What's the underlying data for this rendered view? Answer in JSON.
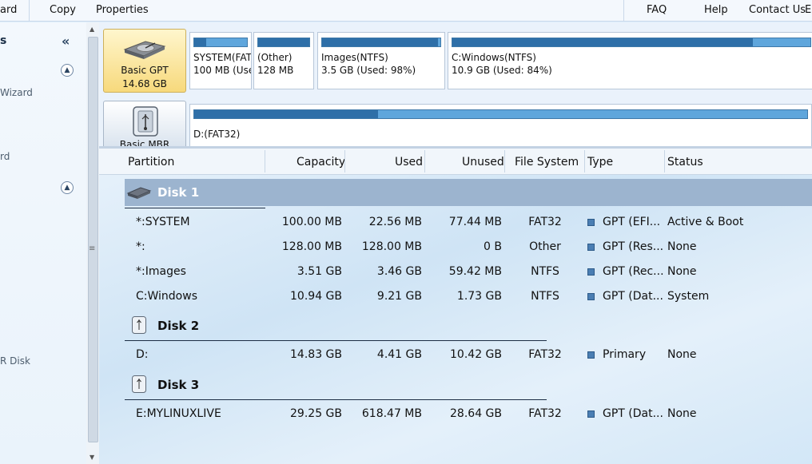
{
  "menu": {
    "wizard_fragment": "ard",
    "copy": "Copy",
    "properties": "Properties",
    "faq": "FAQ",
    "help": "Help",
    "contact": "Contact Us",
    "edge_fragment": "E"
  },
  "sidebar": {
    "head_fragment": "s",
    "item1": "Wizard",
    "item2": "rd",
    "item3": "R Disk"
  },
  "diskmap": {
    "disk1": {
      "label_line1": "Basic GPT",
      "label_line2": "14.68 GB",
      "partitions": [
        {
          "name": "SYSTEM(FAT",
          "info": "100 MB (Use",
          "used_fraction": 0.23
        },
        {
          "name": "(Other)",
          "info": "128 MB",
          "used_fraction": 1.0
        },
        {
          "name": "Images(NTFS)",
          "info": "3.5 GB (Used: 98%)",
          "used_fraction": 0.98
        },
        {
          "name": "C:Windows(NTFS)",
          "info": "10.9 GB (Used: 84%)",
          "used_fraction": 0.84
        }
      ]
    },
    "disk2": {
      "label_line1": "Basic MBR",
      "partition": {
        "name": "D:(FAT32)",
        "used_fraction": 0.3
      }
    }
  },
  "table": {
    "headers": {
      "partition": "Partition",
      "capacity": "Capacity",
      "used": "Used",
      "unused": "Unused",
      "filesystem": "File System",
      "type": "Type",
      "status": "Status"
    },
    "disks": [
      {
        "name": "Disk 1",
        "rows": [
          {
            "partition": "*:SYSTEM",
            "capacity": "100.00 MB",
            "used": "22.56 MB",
            "unused": "77.44 MB",
            "fs": "FAT32",
            "type": "GPT (EFI...",
            "status": "Active & Boot"
          },
          {
            "partition": "*:",
            "capacity": "128.00 MB",
            "used": "128.00 MB",
            "unused": "0 B",
            "fs": "Other",
            "type": "GPT (Res...",
            "status": "None"
          },
          {
            "partition": "*:Images",
            "capacity": "3.51 GB",
            "used": "3.46 GB",
            "unused": "59.42 MB",
            "fs": "NTFS",
            "type": "GPT (Rec...",
            "status": "None"
          },
          {
            "partition": "C:Windows",
            "capacity": "10.94 GB",
            "used": "9.21 GB",
            "unused": "1.73 GB",
            "fs": "NTFS",
            "type": "GPT (Dat...",
            "status": "System"
          }
        ]
      },
      {
        "name": "Disk 2",
        "rows": [
          {
            "partition": "D:",
            "capacity": "14.83 GB",
            "used": "4.41 GB",
            "unused": "10.42 GB",
            "fs": "FAT32",
            "type": "Primary",
            "status": "None"
          }
        ]
      },
      {
        "name": "Disk 3",
        "rows": [
          {
            "partition": "E:MYLINUXLIVE",
            "capacity": "29.25 GB",
            "used": "618.47 MB",
            "unused": "28.64 GB",
            "fs": "FAT32",
            "type": "GPT (Dat...",
            "status": "None"
          }
        ]
      }
    ]
  }
}
